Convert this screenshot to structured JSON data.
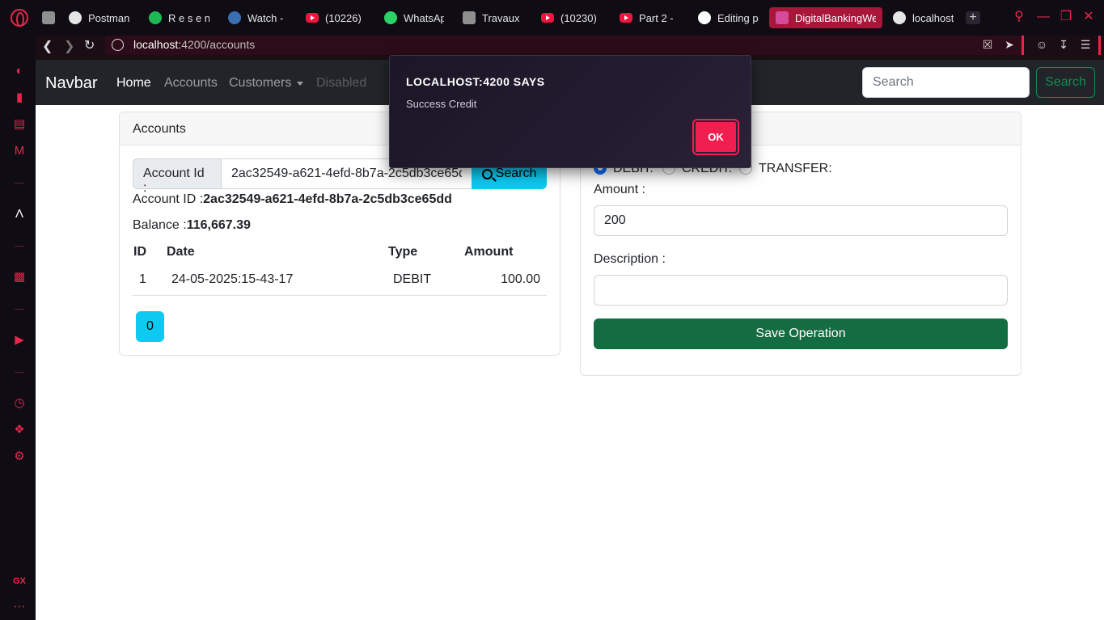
{
  "browser": {
    "tabs": [
      {
        "label": "Postman",
        "icon": "postman-icon"
      },
      {
        "label": "R e s e n",
        "icon": "spotify-icon"
      },
      {
        "label": "Watch -",
        "icon": "disney-icon"
      },
      {
        "label": "(10226)",
        "icon": "youtube-icon"
      },
      {
        "label": "WhatsAp",
        "icon": "whatsapp-icon"
      },
      {
        "label": "Travaux",
        "icon": "classroom-icon"
      },
      {
        "label": "(10230)",
        "icon": "youtube-icon"
      },
      {
        "label": "Part 2 -",
        "icon": "youtube-icon"
      },
      {
        "label": "Editing p",
        "icon": "github-icon"
      },
      {
        "label": "DigitalBankingWe",
        "icon": "angular-icon"
      },
      {
        "label": "localhost",
        "icon": "globe-icon"
      }
    ],
    "url_host": "localhost:",
    "url_rest": "4200/accounts",
    "accent": "#e8264b"
  },
  "navbar": {
    "brand": "Navbar",
    "home": "Home",
    "accounts": "Accounts",
    "customers": "Customers",
    "disabled": "Disabled",
    "search_placeholder": "Search",
    "search_button": "Search"
  },
  "accounts_card": {
    "header": "Accounts",
    "account_label": "Account Id :",
    "account_value": "2ac32549-a621-4efd-8b7a-2c5db3ce65dd",
    "search_button": "Search",
    "account_id_label": "Account ID :",
    "account_id_value": "2ac32549-a621-4efd-8b7a-2c5db3ce65dd",
    "balance_label": "Balance :",
    "balance_value": "116,667.39",
    "table_headers": [
      "ID",
      "Date",
      "Type",
      "Amount"
    ],
    "rows": [
      {
        "id": "1",
        "date": "24-05-2025:15-43-17",
        "type": "DEBIT",
        "amount": "100.00"
      }
    ],
    "page_button": "0"
  },
  "operations_card": {
    "radio_debit": "DEBIT:",
    "radio_credit": "CREDIT:",
    "radio_transfer": "TRANSFER:",
    "amount_label": "Amount :",
    "amount_value": "200",
    "description_label": "Description :",
    "description_value": "",
    "save_button": "Save Operation"
  },
  "dialog": {
    "title": "LOCALHOST:4200 SAYS",
    "message": "Success Credit",
    "ok": "OK"
  }
}
